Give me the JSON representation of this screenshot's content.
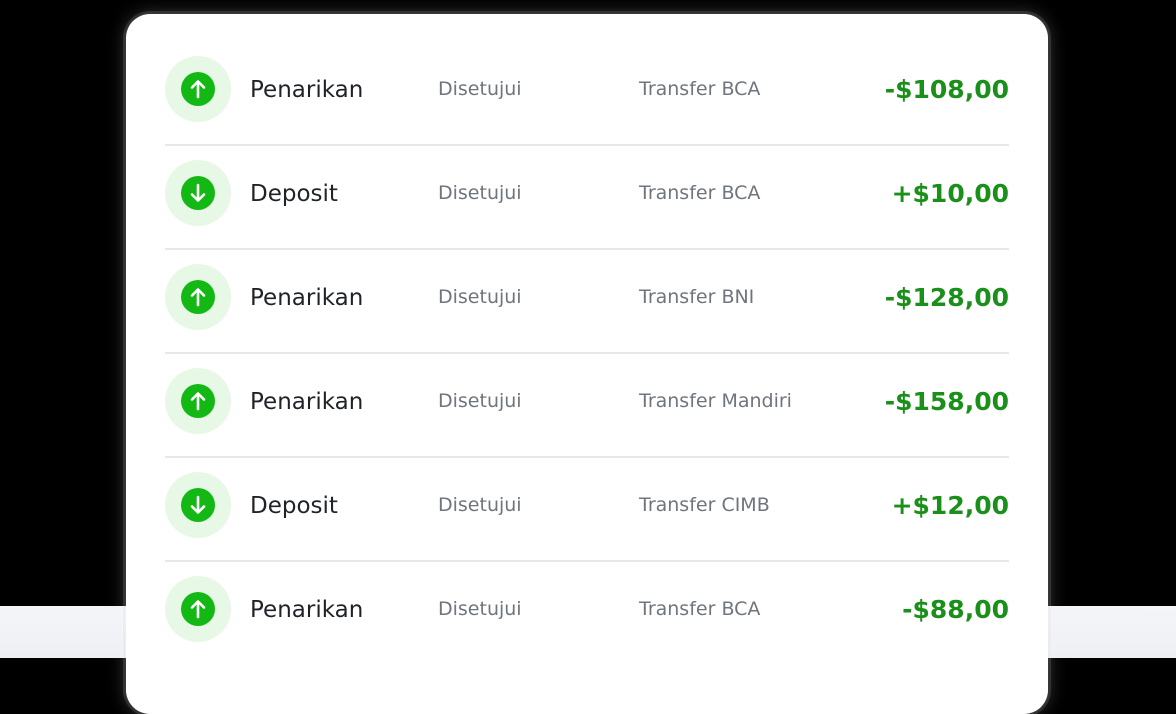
{
  "colors": {
    "accent_green": "#14b814",
    "amount_green": "#1a8f1a",
    "icon_background": "#e8f8e7"
  },
  "transactions": [
    {
      "type": "Penarikan",
      "status": "Disetujui",
      "method": "Transfer BCA",
      "amount": "-$108,00",
      "icon": "arrow-up-icon"
    },
    {
      "type": "Deposit",
      "status": "Disetujui",
      "method": "Transfer BCA",
      "amount": "+$10,00",
      "icon": "arrow-down-icon"
    },
    {
      "type": "Penarikan",
      "status": "Disetujui",
      "method": "Transfer BNI",
      "amount": "-$128,00",
      "icon": "arrow-up-icon"
    },
    {
      "type": "Penarikan",
      "status": "Disetujui",
      "method": "Transfer Mandiri",
      "amount": "-$158,00",
      "icon": "arrow-up-icon"
    },
    {
      "type": "Deposit",
      "status": "Disetujui",
      "method": "Transfer CIMB",
      "amount": "+$12,00",
      "icon": "arrow-down-icon"
    },
    {
      "type": "Penarikan",
      "status": "Disetujui",
      "method": "Transfer BCA",
      "amount": "-$88,00",
      "icon": "arrow-up-icon"
    }
  ]
}
